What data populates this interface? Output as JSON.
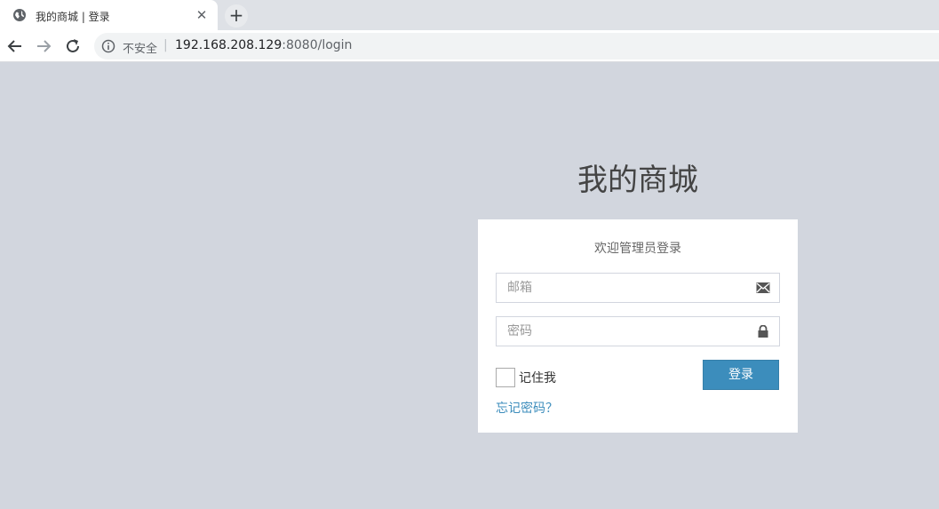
{
  "browser": {
    "tab_title": "我的商城 | 登录",
    "tab_close": "✕",
    "new_tab": "+",
    "insecure_label": "不安全",
    "separator": "|",
    "url_host": "192.168.208.129",
    "url_path": ":8080/login",
    "icons": {
      "favicon": "globe-icon",
      "close": "close-icon",
      "back": "back-arrow-icon",
      "forward": "forward-arrow-icon",
      "reload": "reload-icon",
      "info": "info-icon"
    }
  },
  "page": {
    "logo": "我的商城",
    "box_message": "欢迎管理员登录",
    "email_placeholder": "邮箱",
    "password_placeholder": "密码",
    "remember_label": "记住我",
    "login_button": "登录",
    "forgot_link": "忘记密码？",
    "icons": {
      "email": "envelope-icon",
      "password": "lock-icon"
    },
    "colors": {
      "background": "#d2d6de",
      "primary": "#3c8dbc"
    }
  }
}
